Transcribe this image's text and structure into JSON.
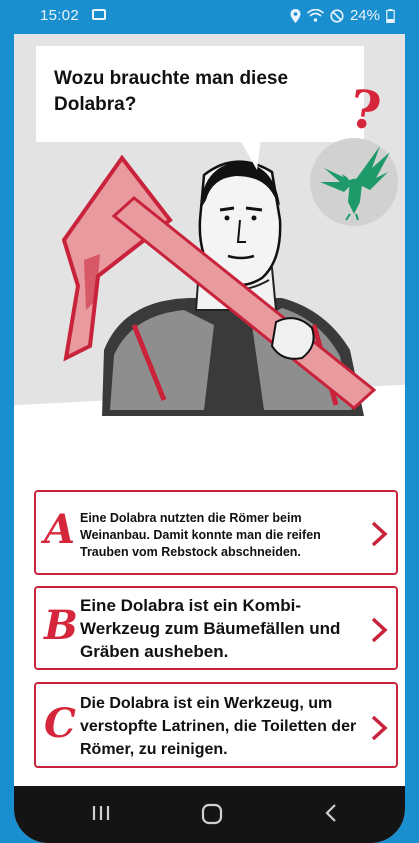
{
  "status": {
    "time": "15:02",
    "battery": "24%",
    "icons": [
      "gallery-icon",
      "location-icon",
      "wifi-icon",
      "dnd-icon",
      "battery-icon"
    ]
  },
  "quiz": {
    "question": "Wozu brauchte man diese Dolabra?",
    "answers": [
      {
        "letter": "A",
        "text": "Eine Dolabra nutzten die Römer beim Weinanbau. Damit konnte man die reifen Trauben vom Rebstock abschneiden."
      },
      {
        "letter": "B",
        "text": "Eine Dolabra ist ein Kombi-Werkzeug zum Bäumefällen und Gräben ausheben."
      },
      {
        "letter": "C",
        "text": "Die Dolabra ist ein Werkzeug, um verstopfte Latrinen, die Toiletten der Römer, zu reinigen."
      }
    ]
  },
  "colors": {
    "accent_red": "#d6263b",
    "frame_blue": "#1a8fd0",
    "eagle_green": "#1e9a6a",
    "hero_grey": "#e3e3e3"
  },
  "nav": {
    "recents_icon": "recents-icon",
    "home_icon": "home-icon",
    "back_icon": "back-icon"
  }
}
